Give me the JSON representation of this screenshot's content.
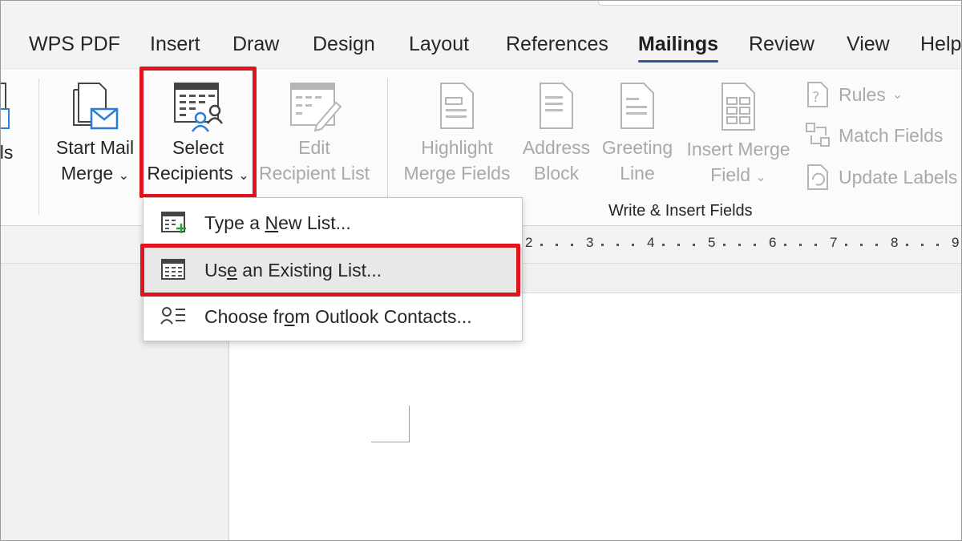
{
  "tabs": [
    "WPS PDF",
    "Insert",
    "Draw",
    "Design",
    "Layout",
    "References",
    "Mailings",
    "Review",
    "View",
    "Help"
  ],
  "active_tab": "Mailings",
  "ribbon": {
    "partial_left_label": "els",
    "start_mail_merge": {
      "line1": "Start Mail",
      "line2": "Merge"
    },
    "select_recipients": {
      "line1": "Select",
      "line2": "Recipients"
    },
    "edit_recipient_list": {
      "line1": "Edit",
      "line2": "Recipient List"
    },
    "highlight_merge_fields": {
      "line1": "Highlight",
      "line2": "Merge Fields"
    },
    "address_block": {
      "line1": "Address",
      "line2": "Block"
    },
    "greeting_line": {
      "line1": "Greeting",
      "line2": "Line"
    },
    "insert_merge_field": {
      "line1": "Insert Merge",
      "line2": "Field"
    },
    "rules": "Rules",
    "match_fields": "Match Fields",
    "update_labels": "Update Labels",
    "group_label": "Write & Insert Fields"
  },
  "dropdown": {
    "items": [
      {
        "pre": "Type a ",
        "key": "N",
        "post": "ew List..."
      },
      {
        "pre": "Us",
        "key": "e",
        "post": " an Existing List..."
      },
      {
        "pre": "Choose fr",
        "key": "o",
        "post": "m Outlook Contacts..."
      }
    ]
  },
  "ruler": {
    "ticks": [
      "2",
      "3",
      "4",
      "5",
      "6",
      "7",
      "8",
      "9"
    ]
  },
  "colors": {
    "highlight_red": "#e0141e",
    "accent_blue": "#2b579a",
    "disabled_gray": "#a9a9a9"
  }
}
